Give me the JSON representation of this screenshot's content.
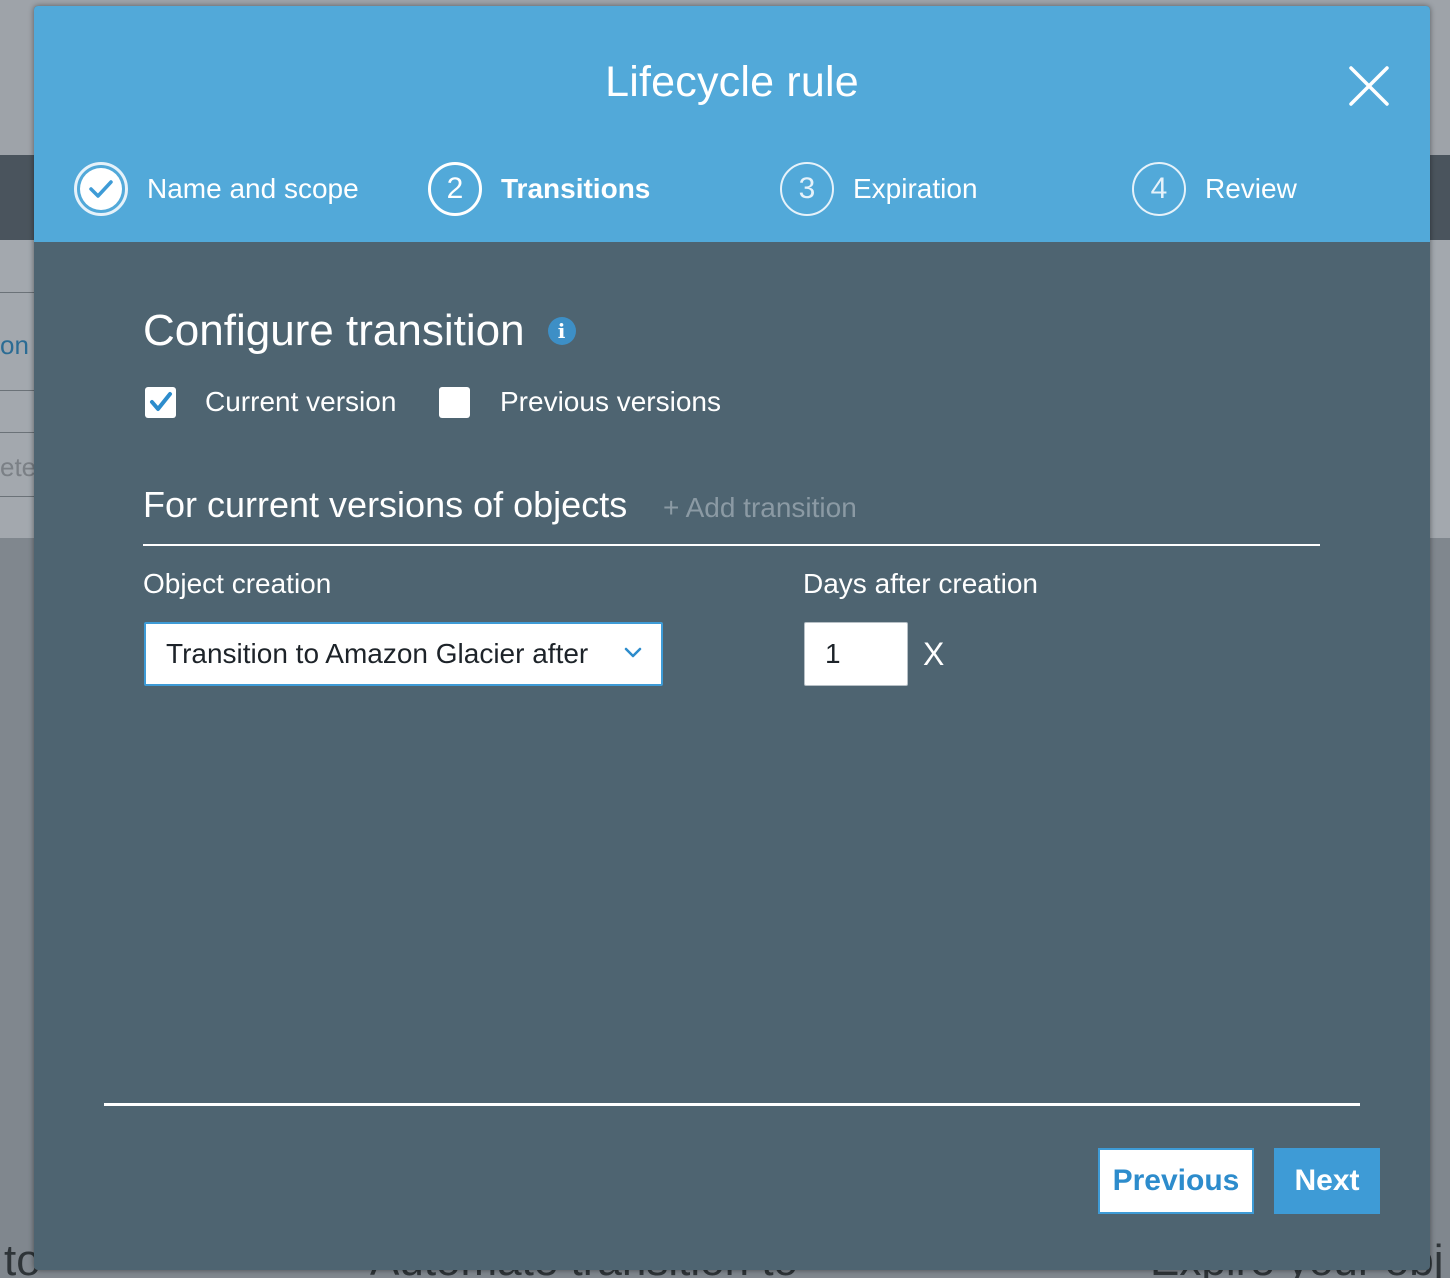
{
  "background": {
    "left_fragment_1": "on",
    "left_fragment_2": "ete",
    "bottom_left_text": "to",
    "bottom_mid_text": "Automate transition to",
    "bottom_right_text": "Expire your obj"
  },
  "modal": {
    "title": "Lifecycle rule",
    "close_icon": "close-icon",
    "steps": [
      {
        "number": "1",
        "label": "Name and scope",
        "state": "done"
      },
      {
        "number": "2",
        "label": "Transitions",
        "state": "active"
      },
      {
        "number": "3",
        "label": "Expiration",
        "state": "pending"
      },
      {
        "number": "4",
        "label": "Review",
        "state": "pending"
      }
    ]
  },
  "configure": {
    "title": "Configure transition",
    "info_icon": "i",
    "current_version": {
      "label": "Current version",
      "checked": true
    },
    "previous_versions": {
      "label": "Previous versions",
      "checked": false
    }
  },
  "current_versions": {
    "title": "For current versions of objects",
    "add_transition": "+ Add transition",
    "object_creation_label": "Object creation",
    "days_label": "Days after creation",
    "transition_select_value": "Transition to Amazon Glacier after",
    "days_value": "1",
    "remove_label": "X"
  },
  "footer": {
    "previous_label": "Previous",
    "next_label": "Next"
  },
  "colors": {
    "header": "#52a9d9",
    "body": "#4e6471",
    "accent": "#3e9bd6"
  }
}
